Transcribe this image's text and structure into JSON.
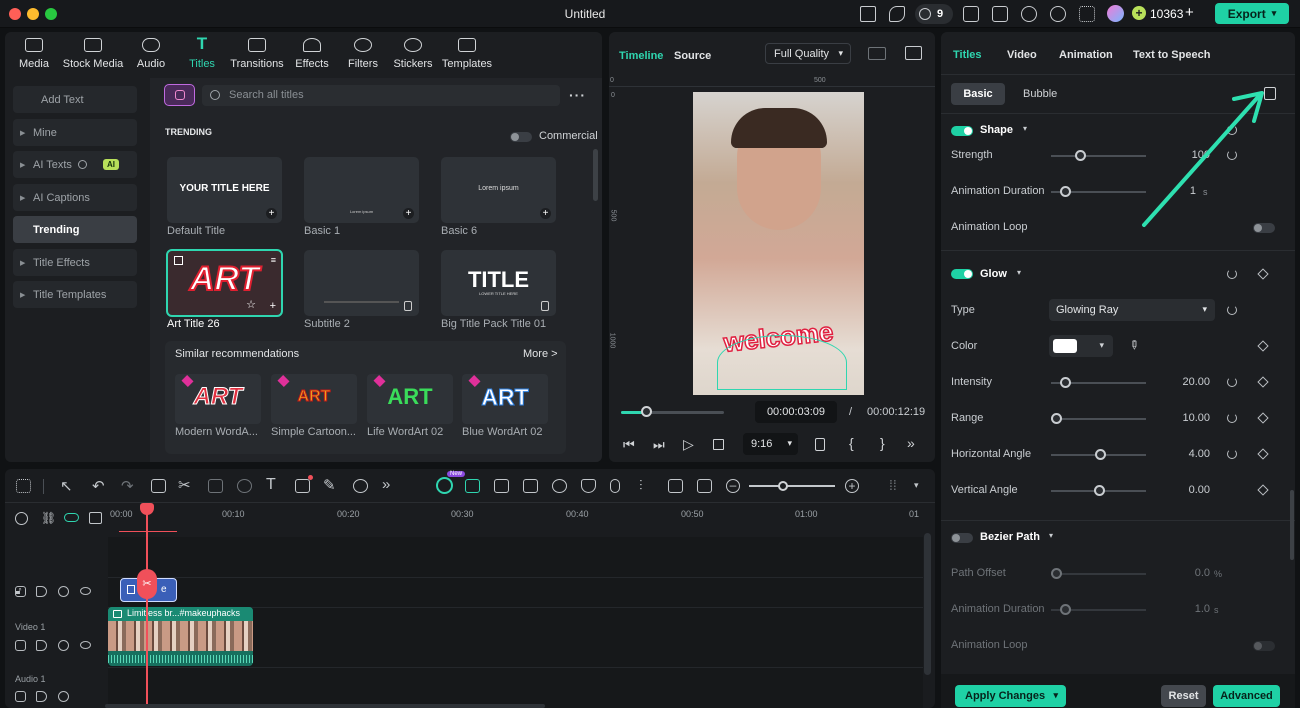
{
  "window": {
    "title": "Untitled",
    "badge": "9",
    "credits": "10363",
    "export_label": "Export"
  },
  "nav_tabs": [
    {
      "label": "Media",
      "icon": "media-icon"
    },
    {
      "label": "Stock Media",
      "icon": "stock-media-icon"
    },
    {
      "label": "Audio",
      "icon": "audio-icon"
    },
    {
      "label": "Titles",
      "icon": "titles-icon"
    },
    {
      "label": "Transitions",
      "icon": "transitions-icon"
    },
    {
      "label": "Effects",
      "icon": "effects-icon"
    },
    {
      "label": "Filters",
      "icon": "filters-icon"
    },
    {
      "label": "Stickers",
      "icon": "stickers-icon"
    },
    {
      "label": "Templates",
      "icon": "templates-icon"
    }
  ],
  "sidebar": {
    "add_text": "Add Text",
    "items": [
      "Mine",
      "AI Texts",
      "AI Captions",
      "Trending",
      "Title Effects",
      "Title Templates"
    ],
    "ai_badge": "AI"
  },
  "search": {
    "placeholder": "Search all titles"
  },
  "section": {
    "heading": "TRENDING",
    "commercial_label": "Commercial"
  },
  "cards": [
    {
      "caption": "Default Title",
      "thumb": "YOUR TITLE HERE"
    },
    {
      "caption": "Basic 1",
      "thumb": "Lorem ipsum"
    },
    {
      "caption": "Basic 6",
      "thumb": "Lorem ipsum"
    },
    {
      "caption": "Art Title 26",
      "thumb": "ART"
    },
    {
      "caption": "Subtitle 2",
      "thumb": ""
    },
    {
      "caption": "Big Title Pack Title 01",
      "thumb": "TITLE",
      "thumb_sub": "LOWER TITLE HERE"
    }
  ],
  "similar": {
    "heading": "Similar recommendations",
    "more": "More >",
    "items": [
      {
        "caption": "Modern WordA...",
        "thumb": "ART"
      },
      {
        "caption": "Simple Cartoon...",
        "thumb": "ART"
      },
      {
        "caption": "Life WordArt 02",
        "thumb": "ART"
      },
      {
        "caption": "Blue WordArt 02",
        "thumb": "ART"
      }
    ]
  },
  "preview": {
    "tab_timeline": "Timeline",
    "tab_source": "Source",
    "quality": "Full Quality",
    "ruler_top": [
      "0",
      "500"
    ],
    "ruler_left": [
      "0",
      "500",
      "1000"
    ],
    "overlay_text": "welcome",
    "current_time": "00:00:03:09",
    "separator": "/",
    "total_time": "00:00:12:19",
    "aspect": "9:16",
    "progress": 0.24
  },
  "props": {
    "tabs": [
      "Titles",
      "Video",
      "Animation",
      "Text to Speech"
    ],
    "subtabs": [
      "Basic",
      "Bubble"
    ],
    "shape": {
      "label": "Shape",
      "enabled": true,
      "strength": {
        "label": "Strength",
        "value": "100",
        "fraction": 0.3
      },
      "duration": {
        "label": "Animation Duration",
        "value": "1",
        "unit": "s",
        "fraction": 0.15
      },
      "loop": {
        "label": "Animation Loop",
        "enabled": false
      }
    },
    "glow": {
      "label": "Glow",
      "enabled": true,
      "type": {
        "label": "Type",
        "value": "Glowing Ray"
      },
      "color": {
        "label": "Color",
        "swatch": "#ffffff"
      },
      "intensity": {
        "label": "Intensity",
        "value": "20.00",
        "fraction": 0.15
      },
      "range": {
        "label": "Range",
        "value": "10.00",
        "fraction": 0.05
      },
      "hangle": {
        "label": "Horizontal Angle",
        "value": "4.00",
        "fraction": 0.52
      },
      "vangle": {
        "label": "Vertical Angle",
        "value": "0.00",
        "fraction": 0.5
      }
    },
    "bezier": {
      "label": "Bezier Path",
      "enabled": false,
      "offset": {
        "label": "Path Offset",
        "value": "0.0",
        "unit": "%",
        "fraction": 0.05
      },
      "duration": {
        "label": "Animation Duration",
        "value": "1.0",
        "unit": "s",
        "fraction": 0.15
      },
      "loop": {
        "label": "Animation Loop"
      }
    },
    "footer": {
      "apply": "Apply Changes",
      "reset": "Reset",
      "advanced": "Advanced"
    }
  },
  "timeline": {
    "ruler": [
      "00:00",
      "00:10",
      "00:20",
      "00:30",
      "00:40",
      "00:50",
      "01:00",
      "01"
    ],
    "tracks": {
      "video1": "Video 1",
      "audio1": "Audio 1"
    },
    "clip_title": "e",
    "clip_video": "Limitless br...#makeuphacks",
    "new_badge": "New"
  },
  "colors": {
    "accent": "#1fd1a5",
    "playhead": "#f0505a"
  }
}
